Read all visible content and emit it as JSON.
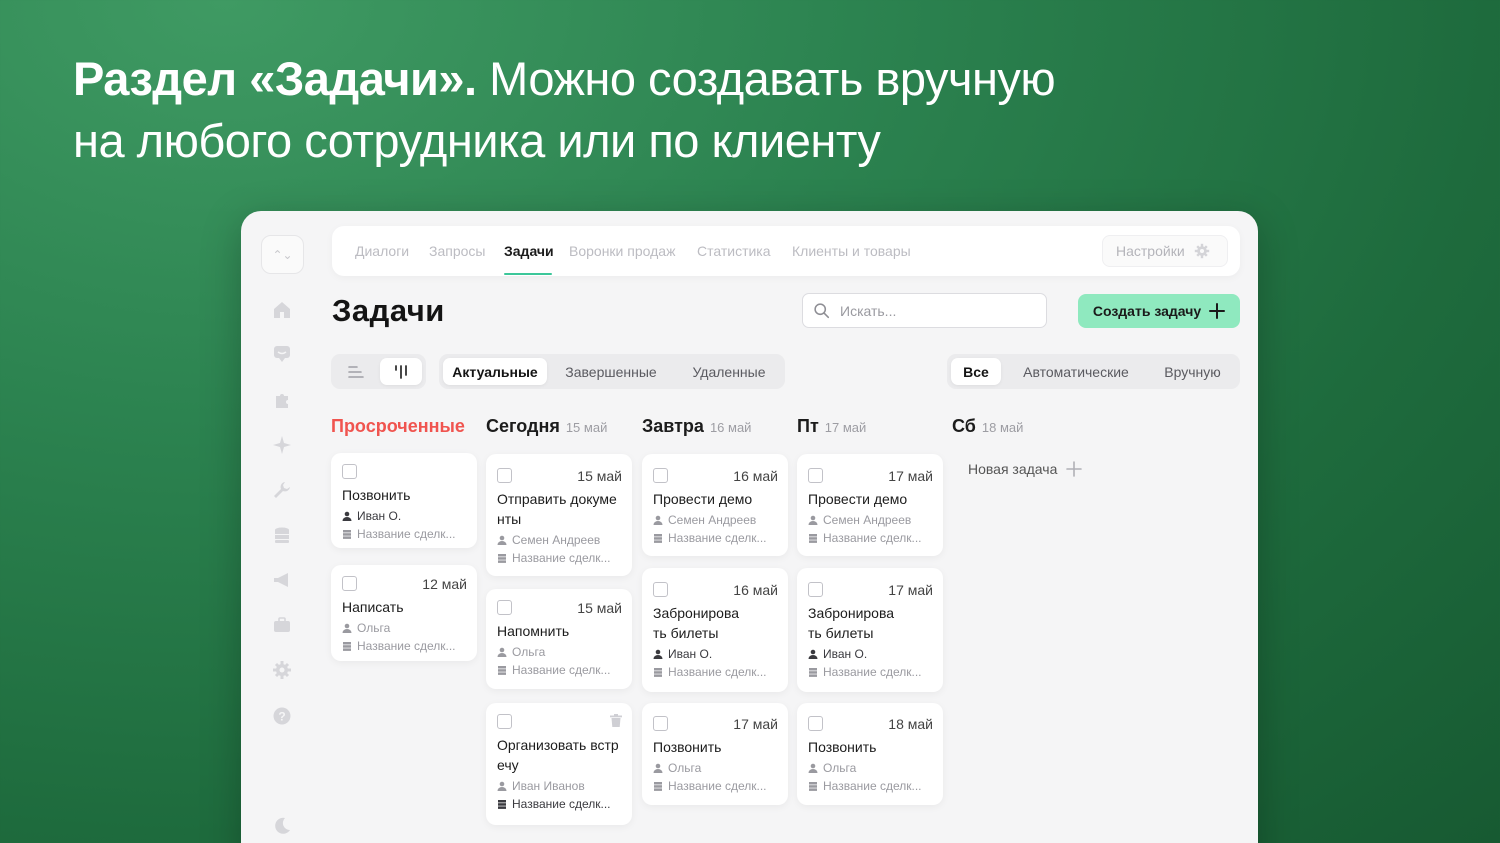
{
  "headline": {
    "bold": "Раздел «Задачи».",
    "line1_rest": " Можно создавать вручную",
    "line2": "на любого сотрудника или по клиенту"
  },
  "nav": {
    "tabs": [
      {
        "label": "Диалоги"
      },
      {
        "label": "Запросы"
      },
      {
        "label": "Задачи",
        "active": true
      },
      {
        "label": "Воронки продаж"
      },
      {
        "label": "Статистика"
      },
      {
        "label": "Клиенты и товары"
      }
    ],
    "settings_label": "Настройки"
  },
  "page": {
    "title": "Задачи",
    "search_placeholder": "Искать...",
    "create_label": "Создать задачу"
  },
  "filters": {
    "status": [
      "Актуальные",
      "Завершенные",
      "Удаленные"
    ],
    "status_selected": "Актуальные",
    "source": [
      "Все",
      "Автоматические",
      "Вручную"
    ],
    "source_selected": "Все"
  },
  "columns": [
    {
      "name": "Просроченные",
      "date": ""
    },
    {
      "name": "Сегодня",
      "date": "15 май"
    },
    {
      "name": "Завтра",
      "date": "16 май"
    },
    {
      "name": "Пт",
      "date": "17 май"
    },
    {
      "name": "Сб",
      "date": "18 май"
    }
  ],
  "cards": [
    {
      "date": "",
      "title": "Позвонить",
      "person": "Иван О.",
      "deal": "Название сделк..."
    },
    {
      "date": "12 май",
      "title": "Написать",
      "person": "Ольга",
      "deal": "Название сделк..."
    },
    {
      "date": "15 май",
      "title": "Отправить документы",
      "person": "Семен Андреев",
      "deal": "Название сделк..."
    },
    {
      "date": "15 май",
      "title": "Напомнить",
      "person": "Ольга",
      "deal": "Название сделк..."
    },
    {
      "date": "",
      "title": "Организовать встречу",
      "person": "Иван Иванов",
      "deal": "Название сделк..."
    },
    {
      "date": "16 май",
      "title": "Провести демо",
      "person": "Семен Андреев",
      "deal": "Название сделк..."
    },
    {
      "date": "16 май",
      "title": "Забронировать билеты",
      "person": "Иван О.",
      "deal": "Название сделк..."
    },
    {
      "date": "17 май",
      "title": "Позвонить",
      "person": "Ольга",
      "deal": "Название сделк..."
    },
    {
      "date": "17 май",
      "title": "Провести демо",
      "person": "Семен Андреев",
      "deal": "Название сделк..."
    },
    {
      "date": "17 май",
      "title": "Забронировать билеты",
      "person": "Иван О.",
      "deal": "Название сделк..."
    },
    {
      "date": "18 май",
      "title": "Позвонить",
      "person": "Ольга",
      "deal": "Название сделк..."
    }
  ],
  "new_task_label": "Новая задача",
  "colors": {
    "accent": "#3cc79a",
    "create_button": "#8fe9bf",
    "overdue": "#f0544f",
    "background_gradient": [
      "#3f9a63",
      "#175a32"
    ]
  },
  "icons": {
    "sidebar": [
      "home-icon",
      "chat-icon",
      "puzzle-icon",
      "sparkle-icon",
      "wrench-icon",
      "coins-icon",
      "megaphone-icon",
      "briefcase-icon",
      "gear-icon",
      "help-icon",
      "moon-icon"
    ]
  }
}
